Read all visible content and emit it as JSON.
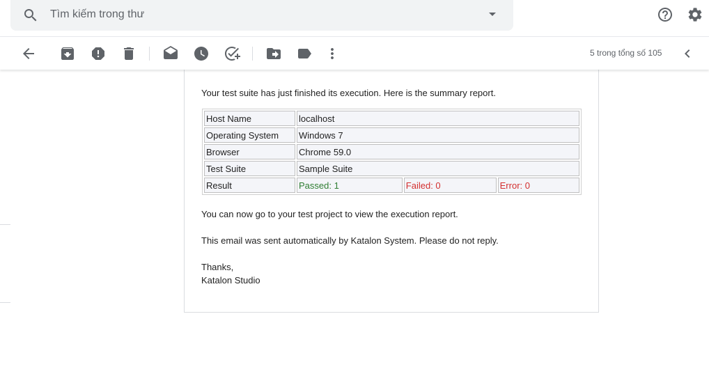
{
  "search": {
    "placeholder": "Tìm kiếm trong thư"
  },
  "icons": {
    "search": "search-icon",
    "dropdown": "dropdown-icon",
    "help": "help-icon",
    "settings": "gear-icon",
    "back": "arrow-left-icon",
    "archive": "archive-icon",
    "spam": "report-spam-icon",
    "delete": "trash-icon",
    "mark_unread": "mark-unread-icon",
    "snooze": "clock-icon",
    "add_task": "add-task-icon",
    "move": "move-to-icon",
    "label": "label-icon",
    "more": "more-vert-icon",
    "prev": "chevron-left-icon"
  },
  "pagination": {
    "text": "5 trong tổng số 105"
  },
  "email": {
    "intro": "Your test suite has just finished its execution. Here is the summary report.",
    "table": {
      "host_label": "Host Name",
      "host_value": "localhost",
      "os_label": "Operating System",
      "os_value": "Windows 7",
      "browser_label": "Browser",
      "browser_value": "Chrome 59.0",
      "suite_label": "Test Suite",
      "suite_value": "Sample Suite",
      "result_label": "Result",
      "passed": "Passed: 1",
      "failed": "Failed: 0",
      "error": "Error: 0"
    },
    "line2": "You can now go to your test project to view the execution report.",
    "line3": "This email was sent automatically by Katalon System. Please do not reply.",
    "thanks": "Thanks,",
    "signature": "Katalon Studio"
  },
  "colors": {
    "passed": "#2e7d32",
    "failed": "#d32f2f",
    "icon": "#5f6368"
  }
}
